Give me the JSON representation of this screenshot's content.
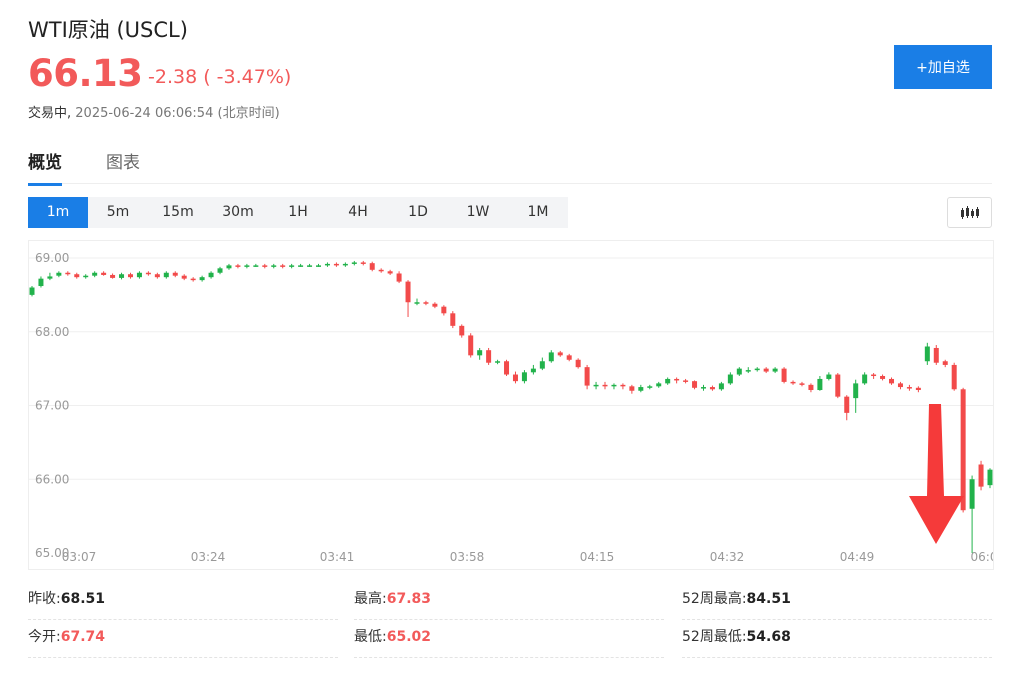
{
  "header": {
    "title": "WTI原油 (USCL)",
    "price": "66.13",
    "change": "-2.38 ( -3.47%)",
    "status_label": "交易中,",
    "timestamp": "2025-06-24 06:06:54",
    "timezone": "(北京时间)",
    "add_button": "+加自选"
  },
  "tabs": [
    {
      "label": "概览",
      "active": true
    },
    {
      "label": "图表",
      "active": false
    }
  ],
  "periods": [
    {
      "label": "1m",
      "active": true
    },
    {
      "label": "5m"
    },
    {
      "label": "15m"
    },
    {
      "label": "30m"
    },
    {
      "label": "1H"
    },
    {
      "label": "4H"
    },
    {
      "label": "1D"
    },
    {
      "label": "1W"
    },
    {
      "label": "1M"
    }
  ],
  "icons": {
    "chart_type": "candlestick-icon",
    "annotation": "down-arrow-icon"
  },
  "colors": {
    "up": "#21b24b",
    "down": "#f24a4a",
    "accent": "#1a7ee6",
    "arrow": "#f53a3a"
  },
  "chart_data": {
    "type": "candlestick",
    "ylim": [
      65.0,
      69.0
    ],
    "y_ticks": [
      "69.00",
      "68.00",
      "67.00",
      "66.00",
      "65.00"
    ],
    "x_ticks": [
      "03:07",
      "03:24",
      "03:41",
      "03:58",
      "04:15",
      "04:32",
      "04:49",
      "06:0"
    ],
    "close": [
      68.6,
      68.72,
      68.75,
      68.8,
      68.78,
      68.74,
      68.76,
      68.8,
      68.77,
      68.73,
      68.78,
      68.74,
      68.8,
      68.78,
      68.74,
      68.8,
      68.76,
      68.72,
      68.7,
      68.74,
      68.8,
      68.86,
      68.9,
      68.88,
      68.9,
      68.9,
      68.88,
      68.9,
      68.88,
      68.9,
      68.9,
      68.9,
      68.9,
      68.92,
      68.9,
      68.92,
      68.94,
      68.93,
      68.84,
      68.82,
      68.79,
      68.68,
      68.4,
      68.4,
      68.38,
      68.34,
      68.25,
      68.08,
      67.95,
      67.68,
      67.75,
      67.58,
      67.6,
      67.42,
      67.33,
      67.45,
      67.5,
      67.6,
      67.72,
      67.68,
      67.62,
      67.52,
      67.27,
      67.28,
      67.26,
      67.28,
      67.26,
      67.2,
      67.25,
      67.26,
      67.3,
      67.36,
      67.34,
      67.33,
      67.24,
      67.25,
      67.22,
      67.3,
      67.42,
      67.5,
      67.48,
      67.5,
      67.46,
      67.5,
      67.32,
      67.3,
      67.28,
      67.21,
      67.36,
      67.42,
      67.12,
      66.9,
      67.3,
      67.42,
      67.4,
      67.36,
      67.3,
      67.25,
      67.24,
      67.21,
      67.8,
      67.58,
      67.55,
      67.22,
      65.58,
      66.0,
      65.9,
      66.13
    ],
    "open": [
      68.5,
      68.62,
      68.72,
      68.76,
      68.8,
      68.78,
      68.74,
      68.76,
      68.8,
      68.77,
      68.73,
      68.78,
      68.74,
      68.8,
      68.78,
      68.74,
      68.8,
      68.76,
      68.72,
      68.7,
      68.74,
      68.8,
      68.86,
      68.9,
      68.88,
      68.9,
      68.9,
      68.88,
      68.9,
      68.88,
      68.9,
      68.9,
      68.9,
      68.9,
      68.92,
      68.9,
      68.92,
      68.94,
      68.93,
      68.84,
      68.82,
      68.79,
      68.68,
      68.4,
      68.4,
      68.38,
      68.34,
      68.25,
      68.08,
      67.95,
      67.68,
      67.75,
      67.58,
      67.6,
      67.42,
      67.33,
      67.45,
      67.5,
      67.6,
      67.72,
      67.68,
      67.62,
      67.52,
      67.27,
      67.28,
      67.26,
      67.28,
      67.26,
      67.2,
      67.25,
      67.26,
      67.3,
      67.36,
      67.34,
      67.33,
      67.24,
      67.25,
      67.22,
      67.3,
      67.42,
      67.48,
      67.48,
      67.5,
      67.46,
      67.5,
      67.32,
      67.3,
      67.28,
      67.21,
      67.36,
      67.42,
      67.12,
      67.1,
      67.3,
      67.42,
      67.4,
      67.36,
      67.3,
      67.25,
      67.24,
      67.6,
      67.78,
      67.6,
      67.55,
      67.22,
      65.6,
      66.2,
      65.92
    ],
    "high": [
      68.62,
      68.75,
      68.8,
      68.82,
      68.82,
      68.8,
      68.78,
      68.82,
      68.82,
      68.79,
      68.8,
      68.8,
      68.82,
      68.82,
      68.8,
      68.82,
      68.82,
      68.78,
      68.74,
      68.76,
      68.82,
      68.88,
      68.92,
      68.92,
      68.92,
      68.92,
      68.92,
      68.92,
      68.92,
      68.92,
      68.92,
      68.92,
      68.92,
      68.94,
      68.94,
      68.94,
      68.96,
      68.96,
      68.95,
      68.86,
      68.84,
      68.82,
      68.7,
      68.45,
      68.42,
      68.4,
      68.36,
      68.28,
      68.1,
      67.98,
      67.78,
      67.78,
      67.62,
      67.62,
      67.46,
      67.48,
      67.55,
      67.65,
      67.75,
      67.74,
      67.7,
      67.64,
      67.55,
      67.32,
      67.32,
      67.3,
      67.3,
      67.28,
      67.28,
      67.28,
      67.32,
      67.38,
      67.38,
      67.36,
      67.34,
      67.28,
      67.27,
      67.32,
      67.45,
      67.52,
      67.52,
      67.52,
      67.52,
      67.52,
      67.52,
      67.34,
      67.32,
      67.3,
      67.4,
      67.45,
      67.44,
      67.14,
      67.35,
      67.45,
      67.44,
      67.42,
      67.38,
      67.32,
      67.28,
      67.26,
      67.85,
      67.82,
      67.62,
      67.58,
      67.24,
      66.05,
      66.25,
      66.15
    ],
    "low": [
      68.48,
      68.6,
      68.7,
      68.74,
      68.76,
      68.72,
      68.72,
      68.74,
      68.76,
      68.72,
      68.71,
      68.72,
      68.72,
      68.76,
      68.72,
      68.72,
      68.74,
      68.7,
      68.68,
      68.68,
      68.72,
      68.78,
      68.84,
      68.86,
      68.86,
      68.88,
      68.86,
      68.86,
      68.86,
      68.86,
      68.88,
      68.88,
      68.88,
      68.88,
      68.88,
      68.88,
      68.9,
      68.9,
      68.82,
      68.8,
      68.77,
      68.66,
      68.2,
      68.36,
      68.36,
      68.32,
      68.22,
      68.05,
      67.92,
      67.65,
      67.62,
      67.55,
      67.56,
      67.4,
      67.3,
      67.3,
      67.42,
      67.48,
      67.58,
      67.66,
      67.6,
      67.5,
      67.22,
      67.22,
      67.22,
      67.22,
      67.22,
      67.16,
      67.18,
      67.22,
      67.24,
      67.28,
      67.3,
      67.3,
      67.22,
      67.2,
      67.2,
      67.2,
      67.28,
      67.4,
      67.44,
      67.46,
      67.44,
      67.44,
      67.3,
      67.28,
      67.26,
      67.18,
      67.2,
      67.34,
      67.1,
      66.8,
      66.9,
      67.28,
      67.36,
      67.34,
      67.28,
      67.22,
      67.2,
      67.18,
      67.55,
      67.55,
      67.52,
      67.2,
      65.55,
      65.0,
      65.85,
      65.88
    ]
  },
  "stats": [
    {
      "label": "昨收:",
      "value": "68.51",
      "red": false
    },
    {
      "label": "最高:",
      "value": "67.83",
      "red": true
    },
    {
      "label": "52周最高:",
      "value": "84.51",
      "red": false
    },
    {
      "label": "今开:",
      "value": "67.74",
      "red": true
    },
    {
      "label": "最低:",
      "value": "65.02",
      "red": true
    },
    {
      "label": "52周最低:",
      "value": "54.68",
      "red": false
    }
  ]
}
